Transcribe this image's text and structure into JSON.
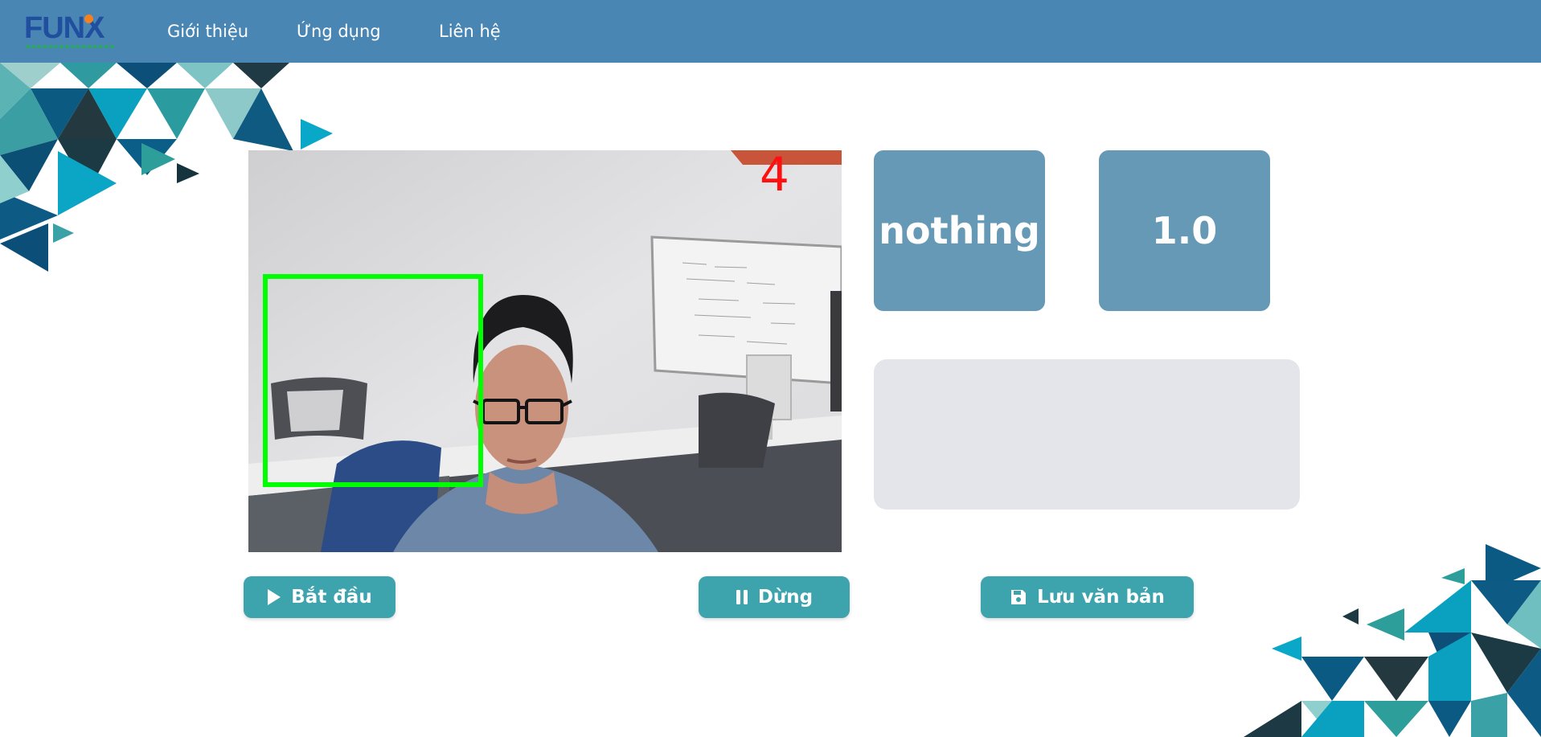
{
  "navbar": {
    "logo_text": "FUNX",
    "links": [
      "Giới thiệu",
      "Ứng dụng",
      "Liên hệ"
    ]
  },
  "video": {
    "overlay_count": "4"
  },
  "prediction": {
    "label": "nothing",
    "score": "1.0"
  },
  "text_area": {
    "value": ""
  },
  "buttons": {
    "start": "Bắt đầu",
    "stop": "Dừng",
    "save": "Lưu văn bản"
  },
  "colors": {
    "navbar": "#4a86b4",
    "card": "#6599b5",
    "button": "#3da3ad",
    "text_area": "#e4e5ea",
    "detection_box": "#00ff00",
    "overlay_count": "#ff1010"
  },
  "icons": {
    "start": "play-icon",
    "stop": "pause-icon",
    "save": "floppy-disk-icon"
  }
}
